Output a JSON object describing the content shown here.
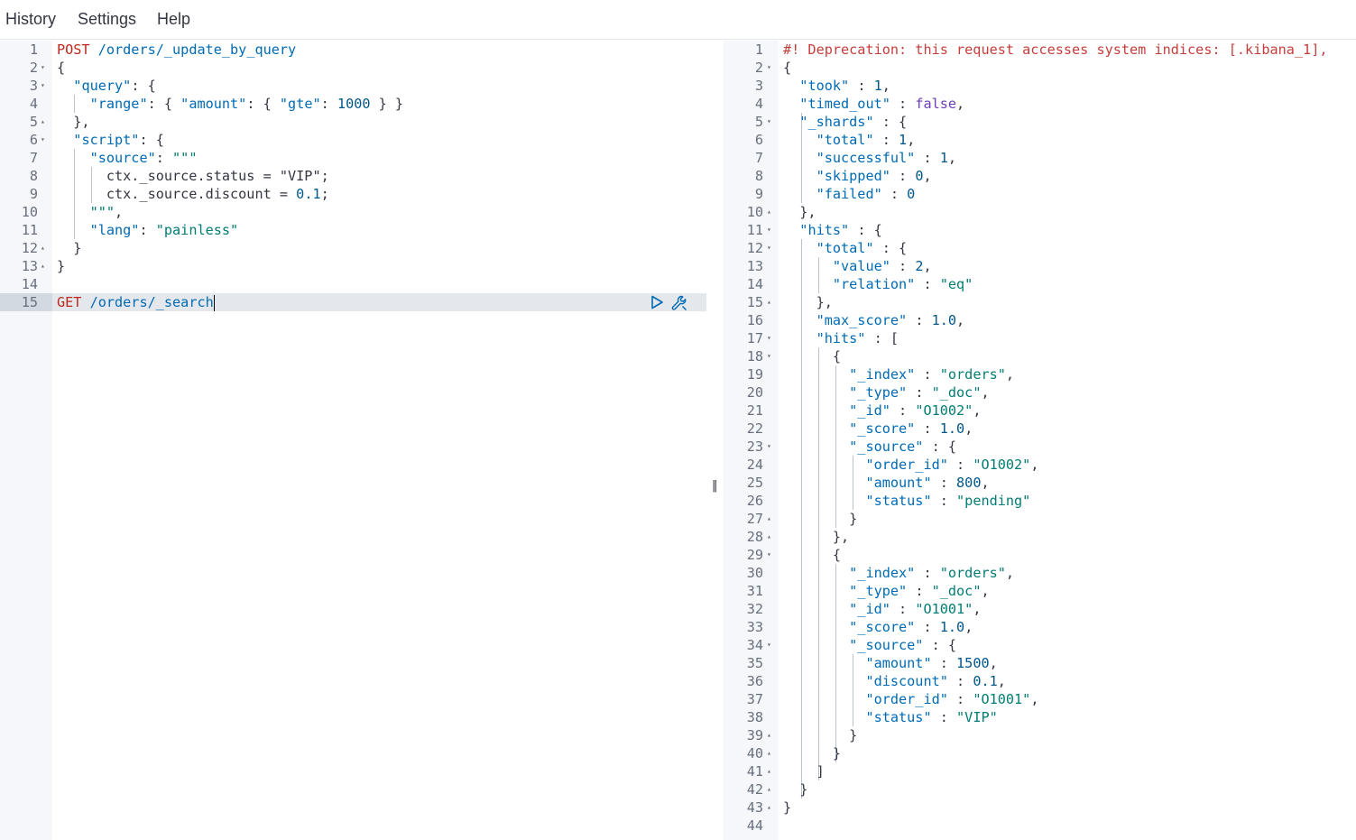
{
  "menu": [
    "History",
    "Settings",
    "Help"
  ],
  "colors": {
    "method": "#bd271e",
    "url": "#006bb4",
    "key": "#006bb4",
    "string": "#017d73",
    "number": "#00578a",
    "boolean": "#6f3eb8",
    "warning": "#c63e3b",
    "punct": "#343741",
    "line_number": "#69707d",
    "active_line": "#e4e7ec",
    "gutter": "#f5f7fa",
    "run_icon": "#006bb4"
  },
  "request": {
    "active_line": 15,
    "lines": [
      {
        "n": "1",
        "fold": "",
        "tokens": [
          [
            "m",
            "POST"
          ],
          [
            "p",
            " "
          ],
          [
            "u",
            "/orders/_update_by_query"
          ]
        ]
      },
      {
        "n": "2",
        "fold": "▾",
        "tokens": [
          [
            "p",
            "{"
          ]
        ]
      },
      {
        "n": "3",
        "fold": "▾",
        "tokens": [
          [
            "p",
            "  "
          ],
          [
            "k",
            "\"query\""
          ],
          [
            "p",
            ": {"
          ]
        ]
      },
      {
        "n": "4",
        "fold": "",
        "tokens": [
          [
            "p",
            "    "
          ],
          [
            "k",
            "\"range\""
          ],
          [
            "p",
            ": { "
          ],
          [
            "k",
            "\"amount\""
          ],
          [
            "p",
            ": { "
          ],
          [
            "k",
            "\"gte\""
          ],
          [
            "p",
            ": "
          ],
          [
            "n",
            "1000"
          ],
          [
            "p",
            " } }"
          ]
        ]
      },
      {
        "n": "5",
        "fold": "▴",
        "tokens": [
          [
            "p",
            "  },"
          ]
        ]
      },
      {
        "n": "6",
        "fold": "▾",
        "tokens": [
          [
            "p",
            "  "
          ],
          [
            "k",
            "\"script\""
          ],
          [
            "p",
            ": {"
          ]
        ]
      },
      {
        "n": "7",
        "fold": "",
        "tokens": [
          [
            "p",
            "    "
          ],
          [
            "k",
            "\"source\""
          ],
          [
            "p",
            ": "
          ],
          [
            "s",
            "\"\"\""
          ]
        ]
      },
      {
        "n": "8",
        "fold": "",
        "tokens": [
          [
            "p",
            "      ctx._source.status = \"VIP\";"
          ]
        ]
      },
      {
        "n": "9",
        "fold": "",
        "tokens": [
          [
            "p",
            "      ctx._source.discount = "
          ],
          [
            "n",
            "0.1"
          ],
          [
            "p",
            ";"
          ]
        ]
      },
      {
        "n": "10",
        "fold": "",
        "tokens": [
          [
            "p",
            "    "
          ],
          [
            "s",
            "\"\"\""
          ],
          [
            "p",
            ","
          ]
        ]
      },
      {
        "n": "11",
        "fold": "",
        "tokens": [
          [
            "p",
            "    "
          ],
          [
            "k",
            "\"lang\""
          ],
          [
            "p",
            ": "
          ],
          [
            "s",
            "\"painless\""
          ]
        ]
      },
      {
        "n": "12",
        "fold": "▴",
        "tokens": [
          [
            "p",
            "  }"
          ]
        ]
      },
      {
        "n": "13",
        "fold": "▴",
        "tokens": [
          [
            "p",
            "}"
          ]
        ]
      },
      {
        "n": "14",
        "fold": "",
        "tokens": []
      },
      {
        "n": "15",
        "fold": "",
        "tokens": [
          [
            "m",
            "GET"
          ],
          [
            "p",
            " "
          ],
          [
            "u",
            "/orders/_search"
          ]
        ]
      }
    ]
  },
  "response": {
    "lines": [
      {
        "n": "1",
        "fold": "",
        "tokens": [
          [
            "w",
            "#! Deprecation: this request accesses system indices: [.kibana_1],"
          ]
        ]
      },
      {
        "n": "2",
        "fold": "▾",
        "tokens": [
          [
            "p",
            "{"
          ]
        ]
      },
      {
        "n": "3",
        "fold": "",
        "tokens": [
          [
            "p",
            "  "
          ],
          [
            "k",
            "\"took\""
          ],
          [
            "p",
            " : "
          ],
          [
            "n",
            "1"
          ],
          [
            "p",
            ","
          ]
        ]
      },
      {
        "n": "4",
        "fold": "",
        "tokens": [
          [
            "p",
            "  "
          ],
          [
            "k",
            "\"timed_out\""
          ],
          [
            "p",
            " : "
          ],
          [
            "b",
            "false"
          ],
          [
            "p",
            ","
          ]
        ]
      },
      {
        "n": "5",
        "fold": "▾",
        "tokens": [
          [
            "p",
            "  "
          ],
          [
            "k",
            "\"_shards\""
          ],
          [
            "p",
            " : {"
          ]
        ]
      },
      {
        "n": "6",
        "fold": "",
        "tokens": [
          [
            "p",
            "    "
          ],
          [
            "k",
            "\"total\""
          ],
          [
            "p",
            " : "
          ],
          [
            "n",
            "1"
          ],
          [
            "p",
            ","
          ]
        ]
      },
      {
        "n": "7",
        "fold": "",
        "tokens": [
          [
            "p",
            "    "
          ],
          [
            "k",
            "\"successful\""
          ],
          [
            "p",
            " : "
          ],
          [
            "n",
            "1"
          ],
          [
            "p",
            ","
          ]
        ]
      },
      {
        "n": "8",
        "fold": "",
        "tokens": [
          [
            "p",
            "    "
          ],
          [
            "k",
            "\"skipped\""
          ],
          [
            "p",
            " : "
          ],
          [
            "n",
            "0"
          ],
          [
            "p",
            ","
          ]
        ]
      },
      {
        "n": "9",
        "fold": "",
        "tokens": [
          [
            "p",
            "    "
          ],
          [
            "k",
            "\"failed\""
          ],
          [
            "p",
            " : "
          ],
          [
            "n",
            "0"
          ]
        ]
      },
      {
        "n": "10",
        "fold": "▴",
        "tokens": [
          [
            "p",
            "  },"
          ]
        ]
      },
      {
        "n": "11",
        "fold": "▾",
        "tokens": [
          [
            "p",
            "  "
          ],
          [
            "k",
            "\"hits\""
          ],
          [
            "p",
            " : {"
          ]
        ]
      },
      {
        "n": "12",
        "fold": "▾",
        "tokens": [
          [
            "p",
            "    "
          ],
          [
            "k",
            "\"total\""
          ],
          [
            "p",
            " : {"
          ]
        ]
      },
      {
        "n": "13",
        "fold": "",
        "tokens": [
          [
            "p",
            "      "
          ],
          [
            "k",
            "\"value\""
          ],
          [
            "p",
            " : "
          ],
          [
            "n",
            "2"
          ],
          [
            "p",
            ","
          ]
        ]
      },
      {
        "n": "14",
        "fold": "",
        "tokens": [
          [
            "p",
            "      "
          ],
          [
            "k",
            "\"relation\""
          ],
          [
            "p",
            " : "
          ],
          [
            "s",
            "\"eq\""
          ]
        ]
      },
      {
        "n": "15",
        "fold": "▴",
        "tokens": [
          [
            "p",
            "    },"
          ]
        ]
      },
      {
        "n": "16",
        "fold": "",
        "tokens": [
          [
            "p",
            "    "
          ],
          [
            "k",
            "\"max_score\""
          ],
          [
            "p",
            " : "
          ],
          [
            "n",
            "1.0"
          ],
          [
            "p",
            ","
          ]
        ]
      },
      {
        "n": "17",
        "fold": "▾",
        "tokens": [
          [
            "p",
            "    "
          ],
          [
            "k",
            "\"hits\""
          ],
          [
            "p",
            " : ["
          ]
        ]
      },
      {
        "n": "18",
        "fold": "▾",
        "tokens": [
          [
            "p",
            "      {"
          ]
        ]
      },
      {
        "n": "19",
        "fold": "",
        "tokens": [
          [
            "p",
            "        "
          ],
          [
            "k",
            "\"_index\""
          ],
          [
            "p",
            " : "
          ],
          [
            "s",
            "\"orders\""
          ],
          [
            "p",
            ","
          ]
        ]
      },
      {
        "n": "20",
        "fold": "",
        "tokens": [
          [
            "p",
            "        "
          ],
          [
            "k",
            "\"_type\""
          ],
          [
            "p",
            " : "
          ],
          [
            "s",
            "\"_doc\""
          ],
          [
            "p",
            ","
          ]
        ]
      },
      {
        "n": "21",
        "fold": "",
        "tokens": [
          [
            "p",
            "        "
          ],
          [
            "k",
            "\"_id\""
          ],
          [
            "p",
            " : "
          ],
          [
            "s",
            "\"O1002\""
          ],
          [
            "p",
            ","
          ]
        ]
      },
      {
        "n": "22",
        "fold": "",
        "tokens": [
          [
            "p",
            "        "
          ],
          [
            "k",
            "\"_score\""
          ],
          [
            "p",
            " : "
          ],
          [
            "n",
            "1.0"
          ],
          [
            "p",
            ","
          ]
        ]
      },
      {
        "n": "23",
        "fold": "▾",
        "tokens": [
          [
            "p",
            "        "
          ],
          [
            "k",
            "\"_source\""
          ],
          [
            "p",
            " : {"
          ]
        ]
      },
      {
        "n": "24",
        "fold": "",
        "tokens": [
          [
            "p",
            "          "
          ],
          [
            "k",
            "\"order_id\""
          ],
          [
            "p",
            " : "
          ],
          [
            "s",
            "\"O1002\""
          ],
          [
            "p",
            ","
          ]
        ]
      },
      {
        "n": "25",
        "fold": "",
        "tokens": [
          [
            "p",
            "          "
          ],
          [
            "k",
            "\"amount\""
          ],
          [
            "p",
            " : "
          ],
          [
            "n",
            "800"
          ],
          [
            "p",
            ","
          ]
        ]
      },
      {
        "n": "26",
        "fold": "",
        "tokens": [
          [
            "p",
            "          "
          ],
          [
            "k",
            "\"status\""
          ],
          [
            "p",
            " : "
          ],
          [
            "s",
            "\"pending\""
          ]
        ]
      },
      {
        "n": "27",
        "fold": "▴",
        "tokens": [
          [
            "p",
            "        }"
          ]
        ]
      },
      {
        "n": "28",
        "fold": "▴",
        "tokens": [
          [
            "p",
            "      },"
          ]
        ]
      },
      {
        "n": "29",
        "fold": "▾",
        "tokens": [
          [
            "p",
            "      {"
          ]
        ]
      },
      {
        "n": "30",
        "fold": "",
        "tokens": [
          [
            "p",
            "        "
          ],
          [
            "k",
            "\"_index\""
          ],
          [
            "p",
            " : "
          ],
          [
            "s",
            "\"orders\""
          ],
          [
            "p",
            ","
          ]
        ]
      },
      {
        "n": "31",
        "fold": "",
        "tokens": [
          [
            "p",
            "        "
          ],
          [
            "k",
            "\"_type\""
          ],
          [
            "p",
            " : "
          ],
          [
            "s",
            "\"_doc\""
          ],
          [
            "p",
            ","
          ]
        ]
      },
      {
        "n": "32",
        "fold": "",
        "tokens": [
          [
            "p",
            "        "
          ],
          [
            "k",
            "\"_id\""
          ],
          [
            "p",
            " : "
          ],
          [
            "s",
            "\"O1001\""
          ],
          [
            "p",
            ","
          ]
        ]
      },
      {
        "n": "33",
        "fold": "",
        "tokens": [
          [
            "p",
            "        "
          ],
          [
            "k",
            "\"_score\""
          ],
          [
            "p",
            " : "
          ],
          [
            "n",
            "1.0"
          ],
          [
            "p",
            ","
          ]
        ]
      },
      {
        "n": "34",
        "fold": "▾",
        "tokens": [
          [
            "p",
            "        "
          ],
          [
            "k",
            "\"_source\""
          ],
          [
            "p",
            " : {"
          ]
        ]
      },
      {
        "n": "35",
        "fold": "",
        "tokens": [
          [
            "p",
            "          "
          ],
          [
            "k",
            "\"amount\""
          ],
          [
            "p",
            " : "
          ],
          [
            "n",
            "1500"
          ],
          [
            "p",
            ","
          ]
        ]
      },
      {
        "n": "36",
        "fold": "",
        "tokens": [
          [
            "p",
            "          "
          ],
          [
            "k",
            "\"discount\""
          ],
          [
            "p",
            " : "
          ],
          [
            "n",
            "0.1"
          ],
          [
            "p",
            ","
          ]
        ]
      },
      {
        "n": "37",
        "fold": "",
        "tokens": [
          [
            "p",
            "          "
          ],
          [
            "k",
            "\"order_id\""
          ],
          [
            "p",
            " : "
          ],
          [
            "s",
            "\"O1001\""
          ],
          [
            "p",
            ","
          ]
        ]
      },
      {
        "n": "38",
        "fold": "",
        "tokens": [
          [
            "p",
            "          "
          ],
          [
            "k",
            "\"status\""
          ],
          [
            "p",
            " : "
          ],
          [
            "s",
            "\"VIP\""
          ]
        ]
      },
      {
        "n": "39",
        "fold": "▴",
        "tokens": [
          [
            "p",
            "        }"
          ]
        ]
      },
      {
        "n": "40",
        "fold": "▴",
        "tokens": [
          [
            "p",
            "      }"
          ]
        ]
      },
      {
        "n": "41",
        "fold": "▴",
        "tokens": [
          [
            "p",
            "    ]"
          ]
        ]
      },
      {
        "n": "42",
        "fold": "▴",
        "tokens": [
          [
            "p",
            "  }"
          ]
        ]
      },
      {
        "n": "43",
        "fold": "▴",
        "tokens": [
          [
            "p",
            "}"
          ]
        ]
      },
      {
        "n": "44",
        "fold": "",
        "tokens": []
      }
    ]
  },
  "icons": {
    "run": "play-icon",
    "actions": "wrench-icon",
    "resize": "drag-handle-icon"
  },
  "resize_grip": "‖"
}
